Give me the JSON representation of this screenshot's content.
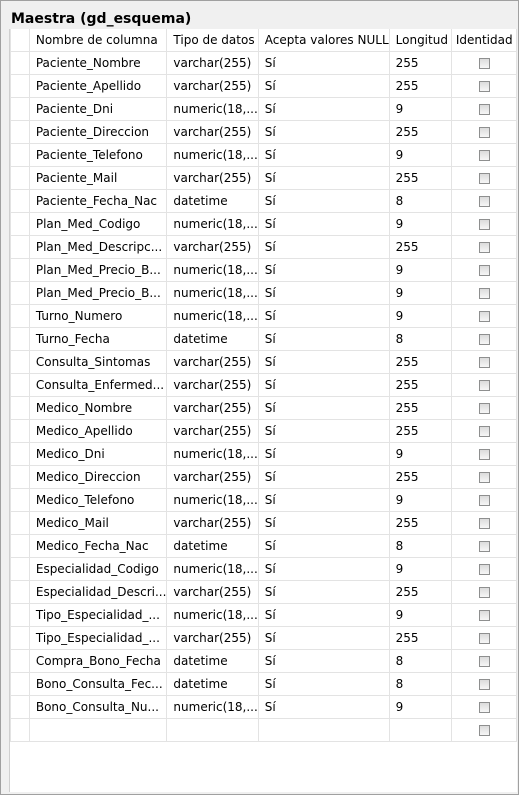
{
  "title": "Maestra (gd_esquema)",
  "columns": {
    "name": "Nombre de columna",
    "type": "Tipo de datos",
    "nullable": "Acepta valores NULL",
    "length": "Longitud",
    "identity": "Identidad"
  },
  "rows": [
    {
      "name": "Paciente_Nombre",
      "type": "varchar(255)",
      "nullable": "Sí",
      "length": "255",
      "identity": false
    },
    {
      "name": "Paciente_Apellido",
      "type": "varchar(255)",
      "nullable": "Sí",
      "length": "255",
      "identity": false
    },
    {
      "name": "Paciente_Dni",
      "type": "numeric(18,...",
      "nullable": "Sí",
      "length": "9",
      "identity": false
    },
    {
      "name": "Paciente_Direccion",
      "type": "varchar(255)",
      "nullable": "Sí",
      "length": "255",
      "identity": false
    },
    {
      "name": "Paciente_Telefono",
      "type": "numeric(18,...",
      "nullable": "Sí",
      "length": "9",
      "identity": false
    },
    {
      "name": "Paciente_Mail",
      "type": "varchar(255)",
      "nullable": "Sí",
      "length": "255",
      "identity": false
    },
    {
      "name": "Paciente_Fecha_Nac",
      "type": "datetime",
      "nullable": "Sí",
      "length": "8",
      "identity": false
    },
    {
      "name": "Plan_Med_Codigo",
      "type": "numeric(18,...",
      "nullable": "Sí",
      "length": "9",
      "identity": false
    },
    {
      "name": "Plan_Med_Descripc...",
      "type": "varchar(255)",
      "nullable": "Sí",
      "length": "255",
      "identity": false
    },
    {
      "name": "Plan_Med_Precio_B...",
      "type": "numeric(18,...",
      "nullable": "Sí",
      "length": "9",
      "identity": false
    },
    {
      "name": "Plan_Med_Precio_B...",
      "type": "numeric(18,...",
      "nullable": "Sí",
      "length": "9",
      "identity": false
    },
    {
      "name": "Turno_Numero",
      "type": "numeric(18,...",
      "nullable": "Sí",
      "length": "9",
      "identity": false
    },
    {
      "name": "Turno_Fecha",
      "type": "datetime",
      "nullable": "Sí",
      "length": "8",
      "identity": false
    },
    {
      "name": "Consulta_Sintomas",
      "type": "varchar(255)",
      "nullable": "Sí",
      "length": "255",
      "identity": false
    },
    {
      "name": "Consulta_Enfermed...",
      "type": "varchar(255)",
      "nullable": "Sí",
      "length": "255",
      "identity": false
    },
    {
      "name": "Medico_Nombre",
      "type": "varchar(255)",
      "nullable": "Sí",
      "length": "255",
      "identity": false
    },
    {
      "name": "Medico_Apellido",
      "type": "varchar(255)",
      "nullable": "Sí",
      "length": "255",
      "identity": false
    },
    {
      "name": "Medico_Dni",
      "type": "numeric(18,...",
      "nullable": "Sí",
      "length": "9",
      "identity": false
    },
    {
      "name": "Medico_Direccion",
      "type": "varchar(255)",
      "nullable": "Sí",
      "length": "255",
      "identity": false
    },
    {
      "name": "Medico_Telefono",
      "type": "numeric(18,...",
      "nullable": "Sí",
      "length": "9",
      "identity": false
    },
    {
      "name": "Medico_Mail",
      "type": "varchar(255)",
      "nullable": "Sí",
      "length": "255",
      "identity": false
    },
    {
      "name": "Medico_Fecha_Nac",
      "type": "datetime",
      "nullable": "Sí",
      "length": "8",
      "identity": false
    },
    {
      "name": "Especialidad_Codigo",
      "type": "numeric(18,...",
      "nullable": "Sí",
      "length": "9",
      "identity": false
    },
    {
      "name": "Especialidad_Descri...",
      "type": "varchar(255)",
      "nullable": "Sí",
      "length": "255",
      "identity": false
    },
    {
      "name": "Tipo_Especialidad_...",
      "type": "numeric(18,...",
      "nullable": "Sí",
      "length": "9",
      "identity": false
    },
    {
      "name": "Tipo_Especialidad_...",
      "type": "varchar(255)",
      "nullable": "Sí",
      "length": "255",
      "identity": false
    },
    {
      "name": "Compra_Bono_Fecha",
      "type": "datetime",
      "nullable": "Sí",
      "length": "8",
      "identity": false
    },
    {
      "name": "Bono_Consulta_Fec...",
      "type": "datetime",
      "nullable": "Sí",
      "length": "8",
      "identity": false
    },
    {
      "name": "Bono_Consulta_Nu...",
      "type": "numeric(18,...",
      "nullable": "Sí",
      "length": "9",
      "identity": false
    }
  ]
}
